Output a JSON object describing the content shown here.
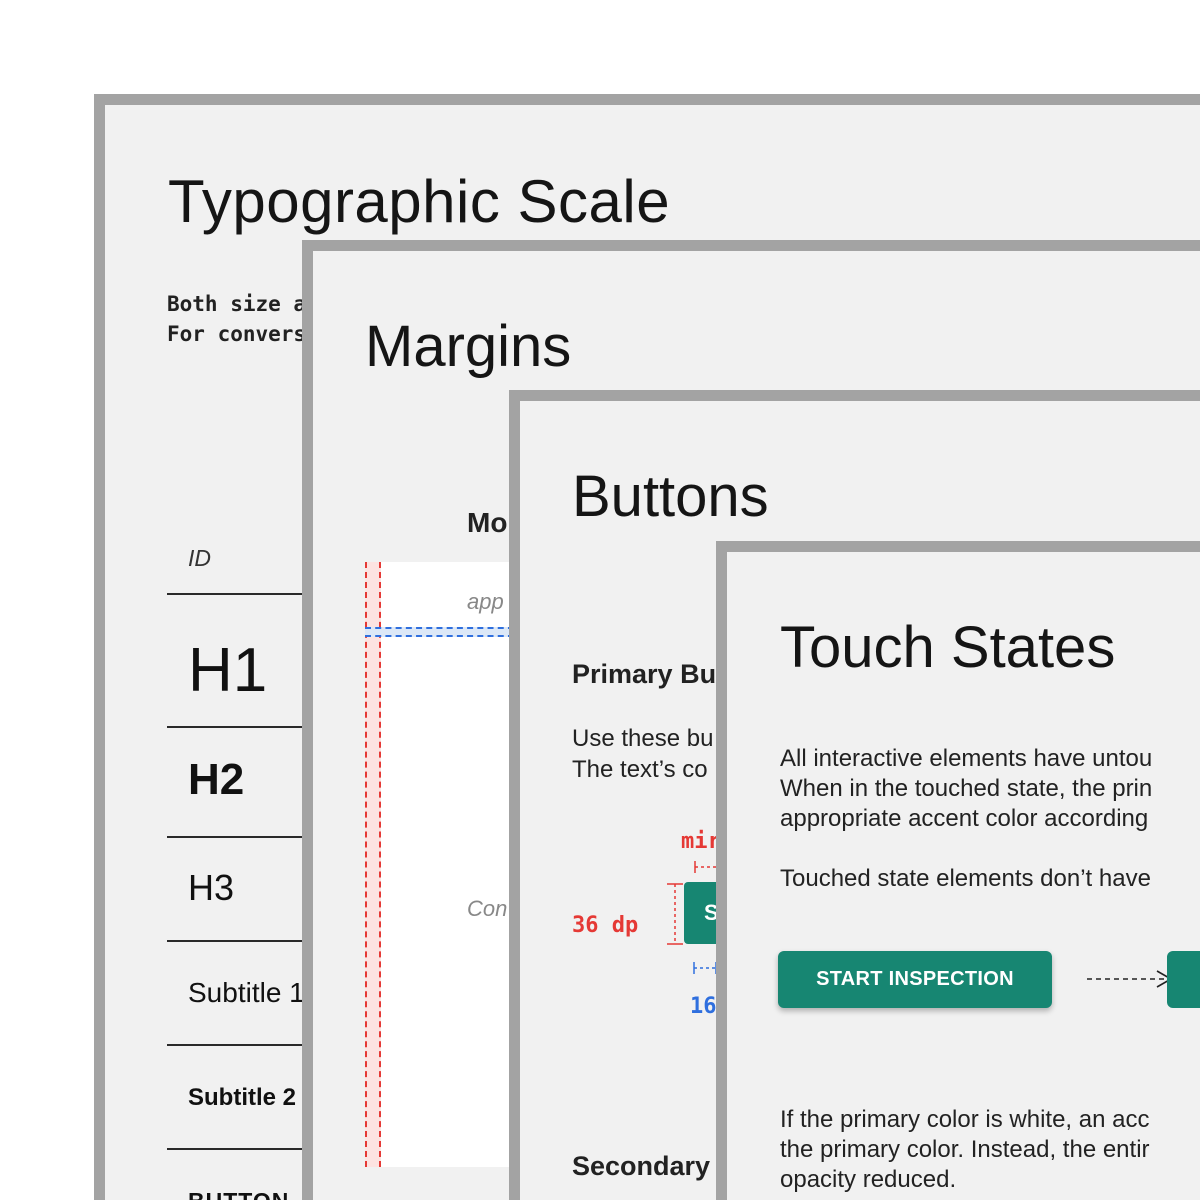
{
  "typographic_scale": {
    "title": "Typographic Scale",
    "description_lines": [
      "Both size a",
      "For convers"
    ],
    "id_header": "ID",
    "rows": [
      "H1",
      "H2",
      "H3",
      "Subtitle 1",
      "Subtitle 2",
      "BUTTON"
    ]
  },
  "margins": {
    "title": "Margins",
    "subheading": "Mo",
    "appbar_label": "app",
    "content_label": "Con"
  },
  "buttons": {
    "title": "Buttons",
    "primary_heading": "Primary Bu",
    "primary_desc_lines": [
      "Use these bu",
      "The text’s co"
    ],
    "min_label": "mir",
    "height_label": "36 dp",
    "padding_label": "16",
    "button_sample_text": "S",
    "secondary_heading": "Secondary"
  },
  "touch_states": {
    "title": "Touch States",
    "paragraph1_lines": [
      "All interactive elements have untou",
      "When in the touched state, the prin",
      "appropriate accent color according"
    ],
    "paragraph2": "Touched state elements don’t have",
    "primary_button_label": "START INSPECTION",
    "arrow_icon": "dashed-arrow-right",
    "paragraph3_lines": [
      "If the primary color is white, an acc",
      "the primary color. Instead, the entir",
      "opacity reduced."
    ]
  },
  "colors": {
    "card_background": "#f1f1f1",
    "card_border": "#a3a3a3",
    "accent_teal": "#178672",
    "guide_red": "#e53935",
    "guide_blue": "#2f6fde"
  }
}
